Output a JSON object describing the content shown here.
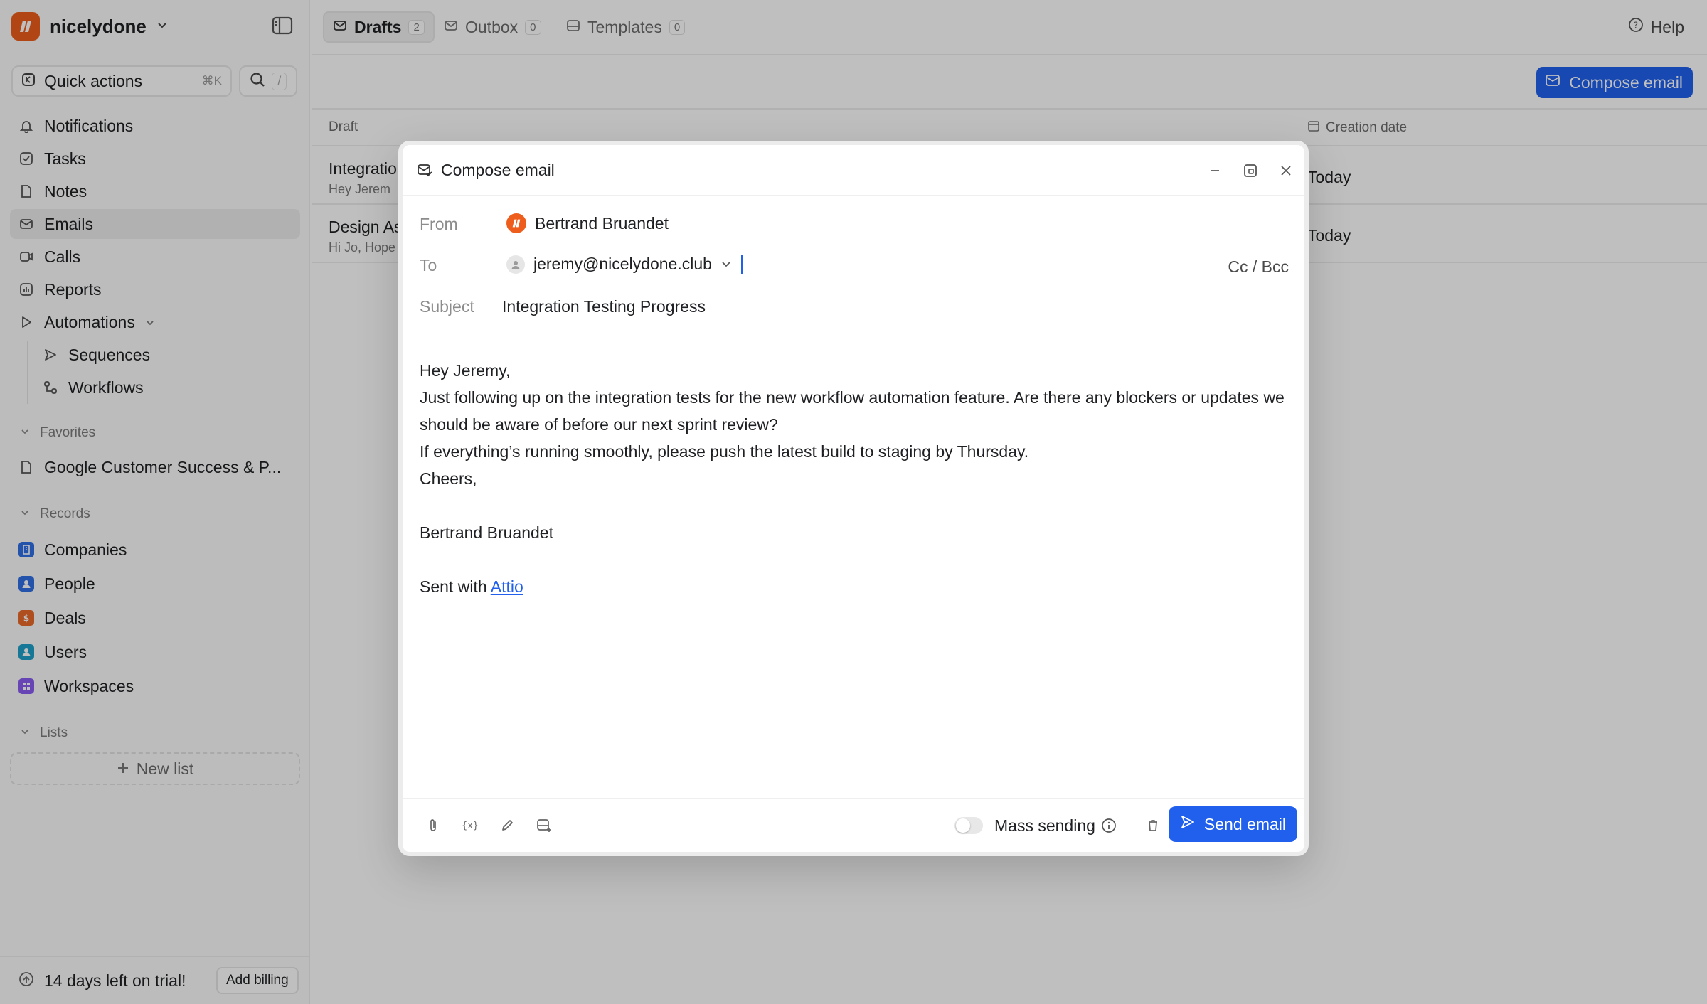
{
  "workspace": {
    "name": "nicelydone"
  },
  "quick_actions": {
    "label": "Quick actions",
    "shortcut": "⌘K",
    "search_shortcut": "/"
  },
  "nav": [
    {
      "label": "Notifications",
      "icon": "bell-icon"
    },
    {
      "label": "Tasks",
      "icon": "checkbox-icon"
    },
    {
      "label": "Notes",
      "icon": "note-icon"
    },
    {
      "label": "Emails",
      "icon": "mail-icon"
    },
    {
      "label": "Calls",
      "icon": "video-icon"
    },
    {
      "label": "Reports",
      "icon": "chart-icon"
    },
    {
      "label": "Automations",
      "icon": "play-icon"
    },
    {
      "label": "Sequences",
      "icon": "send-icon"
    },
    {
      "label": "Workflows",
      "icon": "workflow-icon"
    }
  ],
  "favorites": {
    "title": "Favorites",
    "items": [
      {
        "label": "Google Customer Success & P..."
      }
    ]
  },
  "records": {
    "title": "Records",
    "items": [
      {
        "label": "Companies",
        "color": "#2f6fe4"
      },
      {
        "label": "People",
        "color": "#2f6fe4"
      },
      {
        "label": "Deals",
        "color": "#ea6a2a"
      },
      {
        "label": "Users",
        "color": "#1ea0c8"
      },
      {
        "label": "Workspaces",
        "color": "#8a5cf0"
      }
    ]
  },
  "lists": {
    "title": "Lists",
    "new_label": "New list"
  },
  "trial": {
    "text": "14 days left on trial!",
    "billing_label": "Add billing"
  },
  "tabs": [
    {
      "label": "Drafts",
      "count": "2"
    },
    {
      "label": "Outbox",
      "count": "0"
    },
    {
      "label": "Templates",
      "count": "0"
    }
  ],
  "help_label": "Help",
  "compose_label": "Compose email",
  "table": {
    "col_draft": "Draft",
    "col_date": "Creation date",
    "rows": [
      {
        "title": "Integratio",
        "preview": "Hey Jerem",
        "date": "Today"
      },
      {
        "title": "Design As",
        "preview": "Hi Jo, Hope",
        "date": "Today"
      }
    ]
  },
  "modal": {
    "title": "Compose email",
    "from_label": "From",
    "from_value": "Bertrand Bruandet",
    "to_label": "To",
    "to_value": "jeremy@nicelydone.club",
    "cc_label": "Cc / Bcc",
    "subject_label": "Subject",
    "subject_value": "Integration Testing Progress",
    "body": [
      "Hey Jeremy,",
      "Just following up on the integration tests for the new workflow automation feature. Are there any blockers or updates we should be aware of before our next sprint review?",
      "If everything’s running smoothly, please push the latest build to staging by Thursday.",
      "Cheers,",
      "",
      "Bertrand Bruandet",
      ""
    ],
    "signature_prefix": "Sent with ",
    "signature_link": "Attio",
    "mass_sending_label": "Mass sending",
    "send_label": "Send email"
  },
  "colors": {
    "accent": "#2160ec",
    "brand": "#ee5d1b"
  }
}
